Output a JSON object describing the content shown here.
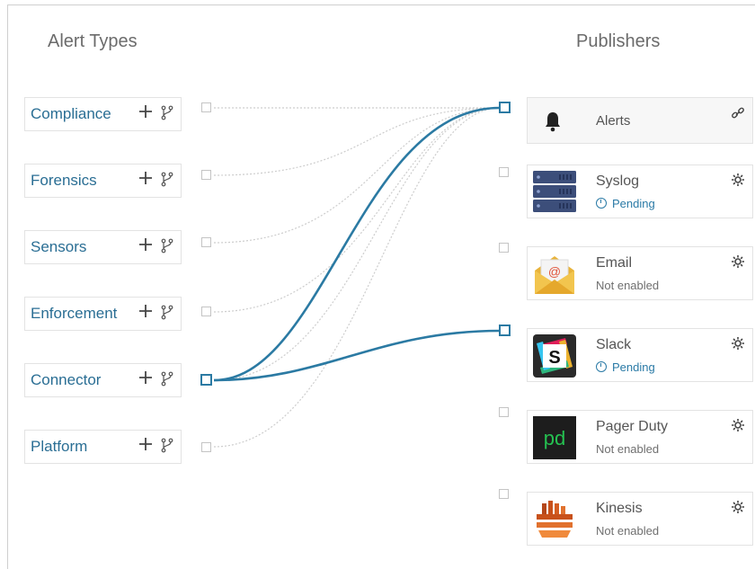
{
  "alert_types_heading": "Alert Types",
  "publishers_heading": "Publishers",
  "alert_types": [
    {
      "label": "Compliance",
      "connected": false
    },
    {
      "label": "Forensics",
      "connected": false
    },
    {
      "label": "Sensors",
      "connected": false
    },
    {
      "label": "Enforcement",
      "connected": false
    },
    {
      "label": "Connector",
      "connected": true
    },
    {
      "label": "Platform",
      "connected": false
    }
  ],
  "publishers": [
    {
      "name": "Alerts",
      "status": "",
      "icon": "bell-icon",
      "action_icon": "link-icon"
    },
    {
      "name": "Syslog",
      "status": "Pending",
      "icon": "server-icon",
      "action_icon": "gear-icon"
    },
    {
      "name": "Email",
      "status": "Not enabled",
      "icon": "email-icon",
      "action_icon": "gear-icon"
    },
    {
      "name": "Slack",
      "status": "Pending",
      "icon": "slack-icon",
      "action_icon": "gear-icon"
    },
    {
      "name": "Pager Duty",
      "status": "Not enabled",
      "icon": "pagerduty-icon",
      "action_icon": "gear-icon"
    },
    {
      "name": "Kinesis",
      "status": "Not enabled",
      "icon": "kinesis-icon",
      "action_icon": "gear-icon"
    }
  ],
  "connections": [
    {
      "from": "Connector",
      "to": "Alerts"
    },
    {
      "from": "Connector",
      "to": "Slack"
    }
  ],
  "colors": {
    "accent": "#2b7aa3",
    "label": "#2a6e94",
    "heading": "#6b6b6b",
    "inactive_line": "#cdcdcd"
  },
  "logo_text": {
    "email": "@",
    "slack": "S",
    "pagerduty": "pd"
  }
}
